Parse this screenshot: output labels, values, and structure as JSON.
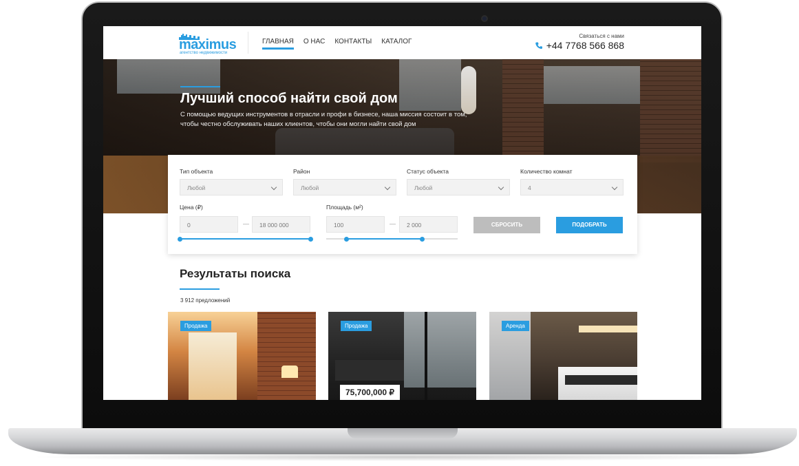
{
  "header": {
    "logo_text": "maximus",
    "logo_subtitle": "агентство недвижимости",
    "nav": [
      {
        "label": "ГЛАВНАЯ",
        "active": true
      },
      {
        "label": "О НАС"
      },
      {
        "label": "КОНТАКТЫ"
      },
      {
        "label": "КАТАЛОГ"
      }
    ],
    "contact_label": "Связаться с нами",
    "phone": "+44 7768 566 868"
  },
  "hero": {
    "title": "Лучший способ найти свой дом",
    "text": "С помощью ведущих инструментов в отрасли и профи в бизнесе, наша миссия состоит в том, чтобы честно обслуживать наших клиентов, чтобы они могли найти свой дом"
  },
  "search": {
    "fields": [
      {
        "label": "Тип объекта",
        "value": "Любой"
      },
      {
        "label": "Район",
        "value": "Любой"
      },
      {
        "label": "Статус объекта",
        "value": "Любой"
      },
      {
        "label": "Количество комнат",
        "value": "4"
      }
    ],
    "price": {
      "label": "Цена (₽)",
      "from": "0",
      "to": "18 000 000",
      "range_fraction": [
        0.0,
        1.0
      ]
    },
    "area": {
      "label": "Площадь (м²)",
      "from": "100",
      "to": "2 000",
      "range_fraction": [
        0.15,
        0.73
      ]
    },
    "separator": "—",
    "reset_label": "СБРОСИТЬ",
    "submit_label": "ПОДОБРАТЬ"
  },
  "results": {
    "title": "Результаты поиска",
    "count": "3 912 предложений",
    "cards": [
      {
        "badge": "Продажа",
        "price": ""
      },
      {
        "badge": "Продажа",
        "price": "75,700,000 ₽"
      },
      {
        "badge": "Аренда",
        "price": ""
      }
    ]
  },
  "colors": {
    "accent": "#2a9de0",
    "reset_button": "#bdbdbd"
  }
}
